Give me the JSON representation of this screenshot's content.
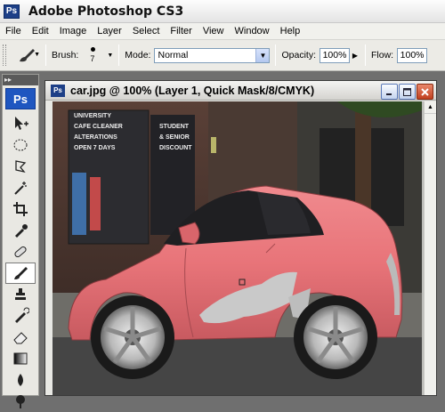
{
  "app": {
    "title": "Adobe Photoshop CS3",
    "logo": "Ps"
  },
  "menu": [
    "File",
    "Edit",
    "Image",
    "Layer",
    "Select",
    "Filter",
    "View",
    "Window",
    "Help"
  ],
  "options": {
    "brush_label": "Brush:",
    "brush_size": "7",
    "mode_label": "Mode:",
    "mode_value": "Normal",
    "opacity_label": "Opacity:",
    "opacity_value": "100%",
    "flow_label": "Flow:",
    "flow_value": "100%"
  },
  "toolbox": {
    "logo": "Ps"
  },
  "document": {
    "title": "car.jpg @ 100% (Layer 1, Quick Mask/8/CMYK)",
    "icon": "Ps"
  },
  "photo": {
    "store_sign_1": [
      "UNIVERSITY",
      "CAFE CLEANER",
      "ALTERATIONS",
      "OPEN 7 DAYS"
    ],
    "store_sign_2": [
      "STUDENT",
      "& SENIOR",
      "DISCOUNT"
    ]
  },
  "colors": {
    "car_mask": "#e87479",
    "title_blue": "#1d3f87"
  }
}
